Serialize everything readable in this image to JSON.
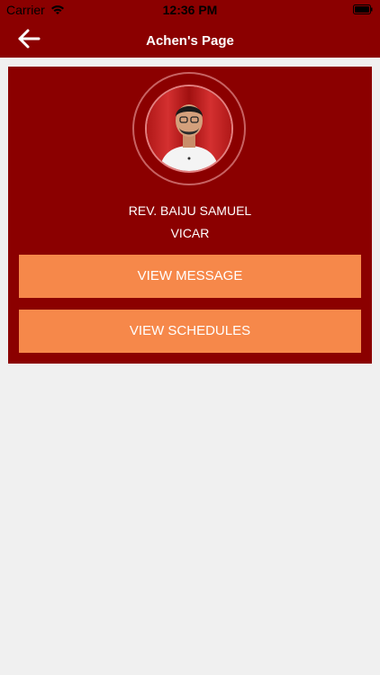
{
  "status_bar": {
    "carrier": "Carrier",
    "time": "12:36 PM",
    "wifi_icon": "wifi-icon",
    "battery_icon": "battery-icon"
  },
  "nav": {
    "title": "Achen's Page",
    "back_icon": "arrow-left-icon"
  },
  "profile": {
    "name": "REV. BAIJU SAMUEL",
    "role": "VICAR",
    "avatar": "profile-photo"
  },
  "actions": {
    "view_message": "VIEW MESSAGE",
    "view_schedules": "VIEW SCHEDULES"
  },
  "colors": {
    "header_bg": "#8b0000",
    "card_bg": "#8b0000",
    "button_bg": "#f6884a",
    "page_bg": "#f0f0f0"
  }
}
